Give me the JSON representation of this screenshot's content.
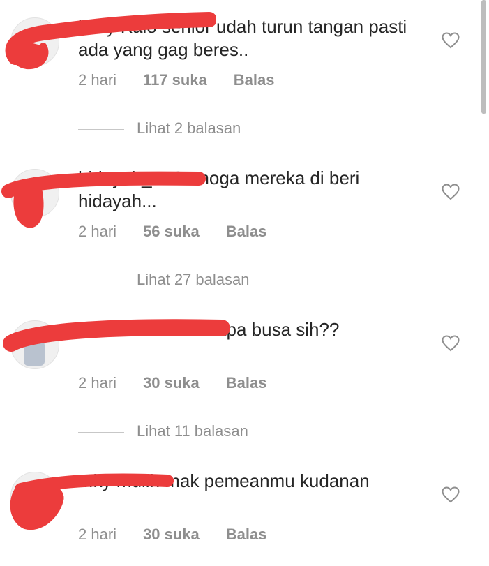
{
  "comments": [
    {
      "username": "l...ky",
      "text": "Kalo senior udah turun tangan pasti ada yang gag beres..",
      "time": "2 hari",
      "likes": "117 suka",
      "reply": "Balas",
      "view_replies": "Lihat 2 balasan"
    },
    {
      "username": "hidayah_...",
      "text": "Semoga mereka di beri hidayah...",
      "time": "2 hari",
      "likes": "56 suka",
      "reply": "Balas",
      "view_replies": "Lihat 27 balasan"
    },
    {
      "username": "...us26",
      "text": "itu bantal apa busa sih??",
      "time": "2 hari",
      "likes": "30 suka",
      "reply": "Balas",
      "view_replies": "Lihat 11 balasan"
    },
    {
      "username": "...ky",
      "text": "mulih mak pemeanmu kudanan",
      "time": "2 hari",
      "likes": "30 suka",
      "reply": "Balas"
    }
  ],
  "colors": {
    "text": "#262626",
    "secondary": "#8e8e8e",
    "redaction": "#ec3c3c"
  },
  "icons": {
    "like": "heart-outline-icon"
  }
}
